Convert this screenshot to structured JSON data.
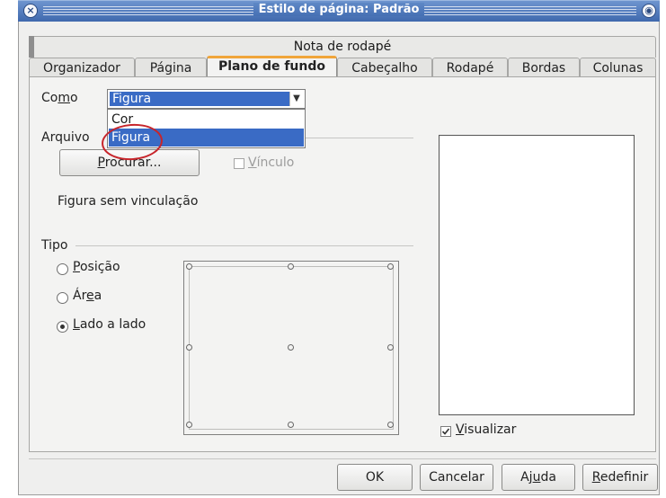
{
  "window": {
    "title": "Estilo de página: Padrão"
  },
  "tabs_row1": [
    "Nota de rodapé"
  ],
  "tabs_row2": [
    "Organizador",
    "Página",
    "Plano de fundo",
    "Cabeçalho",
    "Rodapé",
    "Bordas",
    "Colunas"
  ],
  "active_tab": "Plano de fundo",
  "como": {
    "label_pre": "Co",
    "label_u": "m",
    "label_post": "o",
    "selected": "Figura",
    "options": [
      "Cor",
      "Figura"
    ]
  },
  "arquivo": {
    "heading": "Arquivo",
    "browse_u": "P",
    "browse_rest": "rocurar...",
    "link_u": "V",
    "link_rest": "ínculo",
    "status": "Figura sem vinculação"
  },
  "tipo": {
    "heading": "Tipo",
    "options": [
      {
        "u": "P",
        "rest": "osição",
        "checked": false
      },
      {
        "pre": "Ár",
        "u": "e",
        "rest": "a",
        "checked": false
      },
      {
        "u": "L",
        "rest": "ado a lado",
        "checked": true
      }
    ]
  },
  "preview": {
    "u": "V",
    "rest": "isualizar",
    "checked": true
  },
  "buttons": {
    "ok": "OK",
    "cancel": "Cancelar",
    "help_pre": "Aj",
    "help_u": "u",
    "help_post": "da",
    "reset_u": "R",
    "reset_rest": "edefinir"
  },
  "colors": {
    "accent_tab": "#f0a53a",
    "selection": "#3a6bc5",
    "annotation": "#c7252b"
  }
}
